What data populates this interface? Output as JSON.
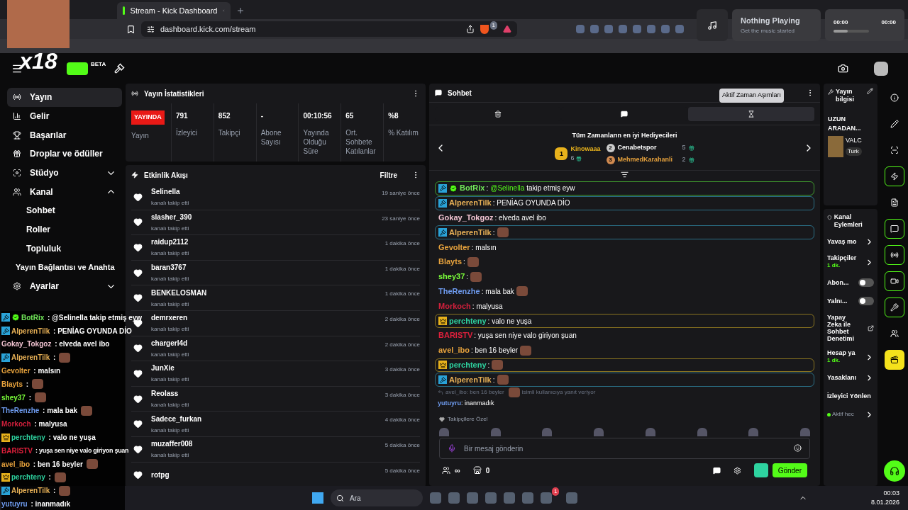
{
  "browser": {
    "tab_title": "Stream - Kick Dashboard",
    "url": "dashboard.kick.com/stream",
    "shield_count": "1"
  },
  "music_widget": {
    "title": "Nothing Playing",
    "subtitle": "Get the music started",
    "time_start": "00:00",
    "time_end": "00:00",
    "level": 0.4
  },
  "overlay": {
    "multiplier": "x18",
    "chat": [
      {
        "user": "BotRix",
        "color": "#72e85a",
        "badges": [
          {
            "kind": "mod"
          },
          {
            "kind": "verified"
          }
        ],
        "text": ": @Selinella takip etmiş eyw",
        "emote": false
      },
      {
        "user": "AlperenTilk",
        "color": "#e7b056",
        "badges": [
          {
            "kind": "mod"
          }
        ],
        "text": ": PENİAG OYUNDA DİO",
        "emote": false
      },
      {
        "user": "Gokay_Tokgoz",
        "color": "#f2c4d2",
        "text": ": elveda avel ibo",
        "emote": false
      },
      {
        "user": "AlperenTilk",
        "color": "#e7b056",
        "badges": [
          {
            "kind": "mod"
          }
        ],
        "text": ":",
        "emote": true
      },
      {
        "user": "Gevolter",
        "color": "#e8a33d",
        "text": ": malsın",
        "emote": false
      },
      {
        "user": "Blayts",
        "color": "#e8a33d",
        "text": ":",
        "emote": true
      },
      {
        "user": "shey37",
        "color": "#7bff3a",
        "text": ":",
        "emote": true
      },
      {
        "user": "TheRenzhe",
        "color": "#6f9cf0",
        "text": ": mala bak",
        "emote": true
      },
      {
        "user": "Morkoch",
        "color": "#d0203c",
        "text": ": malyusa",
        "emote": false
      },
      {
        "user": "perchteny",
        "color": "#2ed3a0",
        "badges": [
          {
            "kind": "crown"
          }
        ],
        "text": ": valo ne yuşa",
        "emote": false
      },
      {
        "user": "BARISTV",
        "color": "#e0203c",
        "text": ": yuşa sen niye valo giriyon şuan",
        "emote": false
      },
      {
        "user": "avel_ibo",
        "color": "#e8a33d",
        "text": ": ben 16 beyler",
        "emote": true
      },
      {
        "user": "perchteny",
        "color": "#2ed3a0",
        "badges": [
          {
            "kind": "crown"
          }
        ],
        "text": ":",
        "emote": true
      },
      {
        "user": "AlperenTilk",
        "color": "#e7b056",
        "badges": [
          {
            "kind": "mod"
          }
        ],
        "text": ":",
        "emote": true
      },
      {
        "user": "yutuyru",
        "color": "#6f9cf0",
        "text": ": inanmadık",
        "emote": false
      }
    ]
  },
  "header": {
    "beta": "BETA"
  },
  "sidebar": {
    "items": [
      {
        "label": "Yayın",
        "selected": true
      },
      {
        "label": "Gelir",
        "selected": false
      },
      {
        "label": "Başarılar",
        "selected": false
      },
      {
        "label": "Droplar ve ödüller",
        "selected": false
      },
      {
        "label": "Stüdyo",
        "selected": false,
        "expanded": false
      },
      {
        "label": "Kanal",
        "selected": false,
        "expanded": true,
        "children": [
          {
            "label": "Sohbet",
            "selected": false
          },
          {
            "label": "Roller",
            "selected": false
          },
          {
            "label": "Topluluk",
            "selected": false
          },
          {
            "label": "Yayın Bağlantısı ve Anahta",
            "selected": false
          }
        ]
      },
      {
        "label": "Ayarlar",
        "selected": false,
        "expanded": false
      }
    ]
  },
  "stats": {
    "title": "Yayın İstatistikleri",
    "status": "YAYINDA",
    "status_label": "Yayın",
    "items": [
      {
        "value": "791",
        "label": "İzleyici"
      },
      {
        "value": "852",
        "label": "Takipçi"
      },
      {
        "value": "-",
        "label": "Abone Sayısı"
      },
      {
        "value": "00:10:56",
        "label": "Yayında Olduğu Süre"
      },
      {
        "value": "65",
        "label": "Ort. Sohbete Katılanlar"
      },
      {
        "value": "%8",
        "label": "% Katılım"
      }
    ]
  },
  "activity": {
    "title": "Etkinlik Akışı",
    "filter": "Filtre",
    "items": [
      {
        "name": "Selinella",
        "action": "kanalı takip etti",
        "time": "19 saniye önce"
      },
      {
        "name": "slasher_390",
        "action": "kanalı takip etti",
        "time": "23 saniye önce"
      },
      {
        "name": "raidup2112",
        "action": "kanalı takip etti",
        "time": "1 dakika önce"
      },
      {
        "name": "baran3767",
        "action": "kanalı takip etti",
        "time": "1 dakika önce"
      },
      {
        "name": "BENKELOSMAN",
        "action": "kanalı takip etti",
        "time": "1 dakika önce"
      },
      {
        "name": "demrxeren",
        "action": "kanalı takip etti",
        "time": "2 dakika önce"
      },
      {
        "name": "chargerl4d",
        "action": "kanalı takip etti",
        "time": "2 dakika önce"
      },
      {
        "name": "JunXie",
        "action": "kanalı takip etti",
        "time": "3 dakika önce"
      },
      {
        "name": "Reolass",
        "action": "kanalı takip etti",
        "time": "3 dakika önce"
      },
      {
        "name": "Sadece_furkan",
        "action": "kanalı takip etti",
        "time": "4 dakika önce"
      },
      {
        "name": "muzaffer008",
        "action": "kanalı takip etti",
        "time": "5 dakika önce"
      },
      {
        "name": "rotpg",
        "time": "5 dakika önce"
      }
    ]
  },
  "chat": {
    "title": "Sohbet",
    "tooltip": "Aktif Zaman Aşımları",
    "tabs": [
      {
        "kind": "trash",
        "selected": false
      },
      {
        "kind": "chat",
        "selected": false
      },
      {
        "kind": "timer",
        "selected": true
      }
    ],
    "gifters": {
      "title": "Tüm Zamanların en iyi Hediyecileri",
      "items": [
        {
          "rank": "1",
          "name": "Kinowaaa",
          "count": "6"
        },
        {
          "rank": "2",
          "name": "Cenabetspor",
          "count": "5"
        },
        {
          "rank": "3",
          "name": "MehmedKarahanli",
          "count": "2"
        }
      ]
    },
    "messages": [
      {
        "user": "BotRix",
        "color": "#72e85a",
        "kind": "bot",
        "badges": [
          {
            "kind": "mod"
          },
          {
            "kind": "verified"
          }
        ],
        "text": ":",
        "mention": "@Selinella",
        "after": "takip etmiş eyw",
        "emote": false
      },
      {
        "user": "AlperenTilk",
        "color": "#e7b056",
        "kind": "mod",
        "badges": [
          {
            "kind": "mod"
          }
        ],
        "text": ": PENİAG OYUNDA DİO",
        "emote": false
      },
      {
        "user": "Gokay_Tokgoz",
        "color": "#f2c4d2",
        "kind": "plain",
        "text": ": elveda avel ibo",
        "emote": false
      },
      {
        "user": "AlperenTilk",
        "color": "#e7b056",
        "kind": "mod",
        "badges": [
          {
            "kind": "mod"
          }
        ],
        "text": ":",
        "emote": true
      },
      {
        "user": "Gevolter",
        "color": "#e8a33d",
        "kind": "plain",
        "text": ": malsın",
        "emote": false
      },
      {
        "user": "Blayts",
        "color": "#e8a33d",
        "kind": "plain",
        "text": ":",
        "emote": true
      },
      {
        "user": "shey37",
        "color": "#7bff3a",
        "kind": "plain",
        "text": ":",
        "emote": true
      },
      {
        "user": "TheRenzhe",
        "color": "#6f9cf0",
        "kind": "plain",
        "text": ": mala bak",
        "emote": true
      },
      {
        "user": "Morkoch",
        "color": "#d0203c",
        "kind": "plain",
        "text": ": malyusa",
        "emote": false
      },
      {
        "user": "perchteny",
        "color": "#2ed3a0",
        "kind": "vip",
        "badges": [
          {
            "kind": "crown"
          }
        ],
        "text": ": valo ne yuşa",
        "emote": false
      },
      {
        "user": "BARISTV",
        "color": "#e0203c",
        "kind": "plain",
        "text": ": yuşa sen niye valo giriyon şuan",
        "emote": false
      },
      {
        "user": "avel_ibo",
        "color": "#e8a33d",
        "kind": "plain",
        "text": ": ben 16 beyler",
        "emote": true
      },
      {
        "user": "perchteny",
        "color": "#2ed3a0",
        "kind": "vip",
        "badges": [
          {
            "kind": "crown"
          }
        ],
        "text": ":",
        "emote": true
      },
      {
        "user": "AlperenTilk",
        "color": "#e7b056",
        "kind": "mod",
        "badges": [
          {
            "kind": "mod"
          }
        ],
        "text": ":",
        "emote": true
      }
    ],
    "reply": {
      "quote": "avel_ibo: ben 16 beyler",
      "note": "isimli kullanıcıya yanıt veriyor"
    },
    "last_message": {
      "user": "yutuyru",
      "color": "#6f9cf0",
      "text": ": inanmadık"
    },
    "emote_section": "Takipçilere Özel",
    "placeholder": "Bir mesaj gönderin",
    "points": "∞",
    "count": "0",
    "send": "Gönder"
  },
  "info": {
    "title": "Yayın bilgisi",
    "stream_title": "UZUN ARADAN...",
    "game": "VALC",
    "tag": "Turk"
  },
  "actions": {
    "title": "Kanal Eylemleri",
    "items": [
      {
        "kind": "link",
        "label": "Yavaş mo"
      },
      {
        "kind": "link",
        "label": "Takipçiler",
        "sub": "1 dk."
      },
      {
        "kind": "toggle",
        "label": "Abon...",
        "on": false
      },
      {
        "kind": "toggle",
        "label": "Yalnı...",
        "on": false
      },
      {
        "kind": "external",
        "label": "Yapay Zeka ile Sohbet Denetimi"
      },
      {
        "kind": "link",
        "label": "Hesap ya",
        "sub": "1 dk."
      },
      {
        "kind": "link",
        "label": "Yasaklanı"
      },
      {
        "kind": "text",
        "label": "İzleyici Yönlen"
      },
      {
        "kind": "status",
        "label": "Aktif hec"
      }
    ]
  },
  "rail": [
    {
      "highlighted": false
    },
    {
      "highlighted": false
    },
    {
      "highlighted": false
    },
    {
      "highlighted": true
    },
    {
      "highlighted": false
    },
    {
      "highlighted": true
    },
    {
      "highlighted": true
    },
    {
      "highlighted": true
    },
    {
      "highlighted": true
    },
    {
      "highlighted": false
    },
    {
      "highlighted": false
    }
  ],
  "taskbar": {
    "search": "Ara",
    "time": "00:03",
    "date": "8.01.2026",
    "discord_badge": "1"
  }
}
